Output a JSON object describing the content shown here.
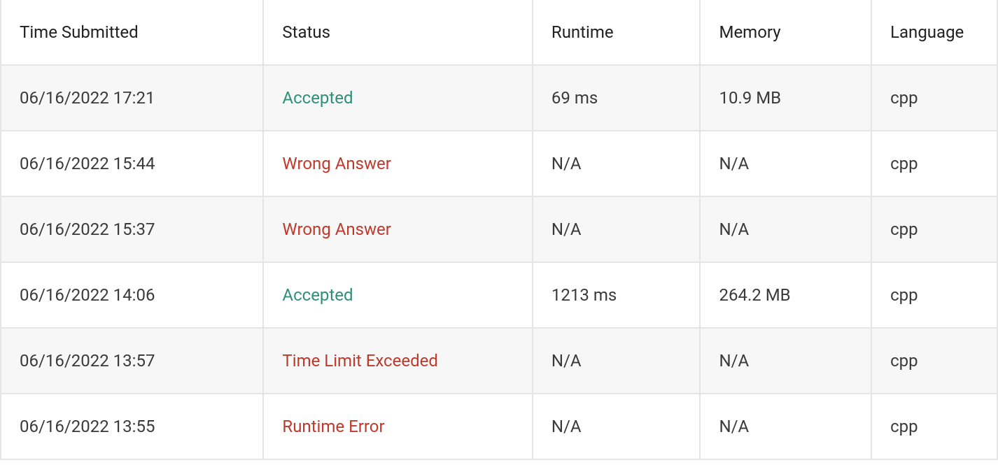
{
  "columns": {
    "time": "Time Submitted",
    "status": "Status",
    "runtime": "Runtime",
    "memory": "Memory",
    "language": "Language"
  },
  "status_colors": {
    "Accepted": "status-accepted",
    "Wrong Answer": "status-error",
    "Time Limit Exceeded": "status-error",
    "Runtime Error": "status-error"
  },
  "rows": [
    {
      "time": "06/16/2022 17:21",
      "status": "Accepted",
      "runtime": "69 ms",
      "memory": "10.9 MB",
      "language": "cpp"
    },
    {
      "time": "06/16/2022 15:44",
      "status": "Wrong Answer",
      "runtime": "N/A",
      "memory": "N/A",
      "language": "cpp"
    },
    {
      "time": "06/16/2022 15:37",
      "status": "Wrong Answer",
      "runtime": "N/A",
      "memory": "N/A",
      "language": "cpp"
    },
    {
      "time": "06/16/2022 14:06",
      "status": "Accepted",
      "runtime": "1213 ms",
      "memory": "264.2 MB",
      "language": "cpp"
    },
    {
      "time": "06/16/2022 13:57",
      "status": "Time Limit Exceeded",
      "runtime": "N/A",
      "memory": "N/A",
      "language": "cpp"
    },
    {
      "time": "06/16/2022 13:55",
      "status": "Runtime Error",
      "runtime": "N/A",
      "memory": "N/A",
      "language": "cpp"
    }
  ]
}
